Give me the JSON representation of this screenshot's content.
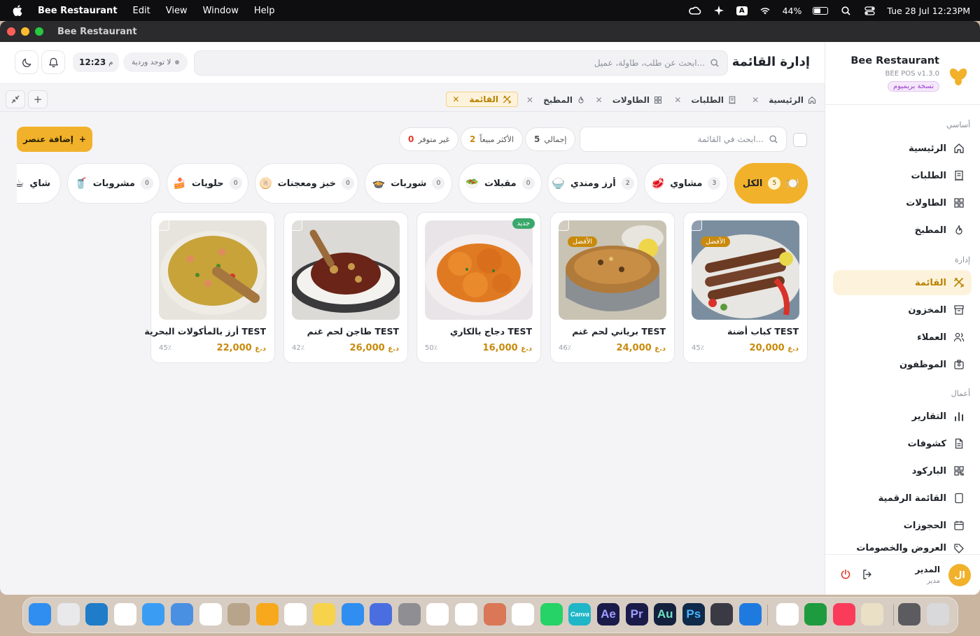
{
  "menubar": {
    "app": "Bee Restaurant",
    "menus": [
      "Edit",
      "View",
      "Window",
      "Help"
    ],
    "battery": "44%",
    "input_indicator": "A",
    "datetime": "Tue 28 Jul  12:23PM"
  },
  "window": {
    "title": "Bee Restaurant"
  },
  "brand": {
    "name": "Bee Restaurant",
    "version": "BEE POS v1.3.0",
    "edition": "نسخة بريميوم"
  },
  "sidebar": {
    "sections": [
      "أساسي",
      "إدارة",
      "أعمال"
    ],
    "items": [
      {
        "label": "الرئيسية",
        "icon": "home-icon"
      },
      {
        "label": "الطلبات",
        "icon": "receipt-icon"
      },
      {
        "label": "الطاولات",
        "icon": "grid-icon"
      },
      {
        "label": "المطبخ",
        "icon": "flame-icon"
      },
      {
        "label": "القائمة",
        "icon": "utensils-icon",
        "active": true
      },
      {
        "label": "المخزون",
        "icon": "archive-icon"
      },
      {
        "label": "العملاء",
        "icon": "users-icon"
      },
      {
        "label": "الموظفون",
        "icon": "id-card-icon"
      },
      {
        "label": "التقارير",
        "icon": "bar-chart-icon"
      },
      {
        "label": "كشوفات",
        "icon": "document-icon"
      },
      {
        "label": "الباركود",
        "icon": "qr-icon"
      },
      {
        "label": "القائمة الرقمية",
        "icon": "tablet-icon"
      },
      {
        "label": "الحجوزات",
        "icon": "calendar-icon"
      },
      {
        "label": "العروض والخصومات",
        "icon": "tag-icon"
      }
    ],
    "user": {
      "initials": "ال",
      "name": "المدير",
      "role": "مدير"
    }
  },
  "header": {
    "title": "إدارة القائمة",
    "search_placeholder": "ابحث عن طلب، طاولة، عميل...",
    "shift": "لا توجد وردية",
    "time": "12:23",
    "time_suffix": "م"
  },
  "tabs": [
    {
      "label": "الرئيسية",
      "icon": "home-icon"
    },
    {
      "label": "الطلبات",
      "icon": "receipt-icon"
    },
    {
      "label": "الطاولات",
      "icon": "grid-icon"
    },
    {
      "label": "المطبخ",
      "icon": "flame-icon"
    },
    {
      "label": "القائمة",
      "icon": "utensils-icon",
      "active": true
    }
  ],
  "toolbar": {
    "search_placeholder": "ابحث في القائمة...",
    "stats": [
      {
        "label": "إجمالي",
        "value": "5",
        "color": "#1f2329"
      },
      {
        "label": "الأكثر مبيعاً",
        "value": "2",
        "color": "#c98a0c"
      },
      {
        "label": "غير متوفر",
        "value": "0",
        "color": "#e0392b"
      }
    ],
    "add_label": "إضافة عنصر"
  },
  "categories": [
    {
      "label": "الكل",
      "count": "5",
      "emoji": "🍽️",
      "active": true
    },
    {
      "label": "مشاوي",
      "count": "3",
      "emoji": "🥩"
    },
    {
      "label": "أرز ومندي",
      "count": "2",
      "emoji": "🍚"
    },
    {
      "label": "مقبلات",
      "count": "0",
      "emoji": "🥗"
    },
    {
      "label": "شوربات",
      "count": "0",
      "emoji": "🍲"
    },
    {
      "label": "خبز ومعجنات",
      "count": "0",
      "emoji": "🫓"
    },
    {
      "label": "حلويات",
      "count": "0",
      "emoji": "🍰"
    },
    {
      "label": "مشروبات",
      "count": "0",
      "emoji": "🥤"
    },
    {
      "label": "شاي",
      "count": "",
      "emoji": "☕"
    }
  ],
  "products": [
    {
      "name": "كباب أضنة TEST",
      "price": "20,000",
      "currency": "د.ع",
      "percent": "45٪",
      "badge": "الأفضل",
      "badge_type": "best"
    },
    {
      "name": "برياني لحم غنم TEST",
      "price": "24,000",
      "currency": "د.ع",
      "percent": "46٪",
      "badge": "الأفضل",
      "badge_type": "best"
    },
    {
      "name": "دجاج بالكاري TEST",
      "price": "16,000",
      "currency": "د.ع",
      "percent": "50٪",
      "badge": "جديد",
      "badge_type": "new"
    },
    {
      "name": "طاجن لحم غنم TEST",
      "price": "26,000",
      "currency": "د.ع",
      "percent": "42٪",
      "badge": "",
      "badge_type": ""
    },
    {
      "name": "أرز بالمأكولات البحرية TEST",
      "price": "22,000",
      "currency": "د.ع",
      "percent": "45٪",
      "badge": "",
      "badge_type": ""
    }
  ],
  "colors": {
    "accent": "#f1b12a",
    "accent_dark": "#c98a0c",
    "premium": "#9b3fcf"
  },
  "dock": [
    {
      "name": "finder-icon",
      "color": "#2f8ef0"
    },
    {
      "name": "launchpad-icon",
      "color": "#e9e9ec"
    },
    {
      "name": "edge-icon",
      "color": "#1e7cc8"
    },
    {
      "name": "chrome-icon",
      "color": "#ffffff"
    },
    {
      "name": "safari-icon",
      "color": "#3a9df3"
    },
    {
      "name": "mail-icon",
      "color": "#4a90e2"
    },
    {
      "name": "photos-icon",
      "color": "#ffffff"
    },
    {
      "name": "contacts-icon",
      "color": "#b8a48a"
    },
    {
      "name": "pages-icon",
      "color": "#f7a81d"
    },
    {
      "name": "reminders-icon",
      "color": "#ffffff"
    },
    {
      "name": "notes-icon",
      "color": "#f6d34a"
    },
    {
      "name": "app-store-icon",
      "color": "#2f8ef0"
    },
    {
      "name": "simulator-icon",
      "color": "#4a6ee0"
    },
    {
      "name": "system-settings-icon",
      "color": "#8e8e93"
    },
    {
      "name": "chatgpt-icon",
      "color": "#ffffff"
    },
    {
      "name": "gemini-icon",
      "color": "#ffffff"
    },
    {
      "name": "claude-icon",
      "color": "#d97757"
    },
    {
      "name": "vscode-icon",
      "color": "#ffffff"
    },
    {
      "name": "whatsapp-icon",
      "color": "#25d366"
    },
    {
      "name": "canva-icon",
      "color": "#1fb6c7",
      "text": "Canva"
    },
    {
      "name": "after-effects-icon",
      "color": "#1b1b4a",
      "text": "Ae"
    },
    {
      "name": "premiere-icon",
      "color": "#1b1b4a",
      "text": "Pr"
    },
    {
      "name": "audition-icon",
      "color": "#14213d",
      "text": "Au"
    },
    {
      "name": "photoshop-icon",
      "color": "#0f2a4a",
      "text": "Ps"
    },
    {
      "name": "davinci-icon",
      "color": "#3a3a44"
    },
    {
      "name": "quicktime-icon",
      "color": "#1f7ae0"
    },
    {
      "name": "textedit-icon",
      "color": "#ffffff"
    },
    {
      "name": "numbers-icon",
      "color": "#1e9b3e"
    },
    {
      "name": "music-icon",
      "color": "#fa3c5a"
    },
    {
      "name": "bee-restaurant-icon",
      "color": "#e9e0c6"
    },
    {
      "name": "downloads-icon",
      "color": "#5b5b60"
    },
    {
      "name": "trash-icon",
      "color": "#d9d9dc"
    }
  ]
}
